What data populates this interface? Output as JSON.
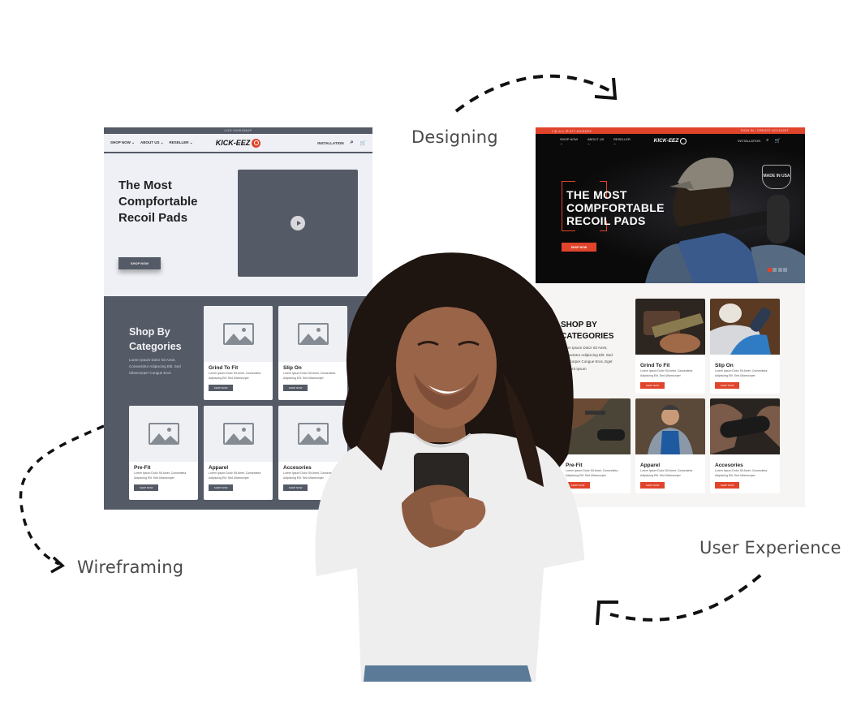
{
  "labels": {
    "designing": "Designing",
    "wireframing": "Wireframing",
    "user_experience": "User Experience"
  },
  "wireframe": {
    "topbar": "LOG IN/SIGNUP",
    "nav": {
      "menu": [
        "SHOP NOW ⌄",
        "ABOUT US ⌄",
        "RESELLER ⌄"
      ],
      "logo": "KICK-EEZ",
      "installation": "INSTALLATION",
      "search_icon": "⌕",
      "cart_icon": "🛒"
    },
    "hero": {
      "title": "The Most Compfortable Recoil Pads",
      "button": "SHOP NOW",
      "video_icon": "play-icon"
    },
    "categories": {
      "title": "Shop By Categories",
      "description": "Lorem Ipsum Dolor Sit Amet, Consectetur Adipiscing Elit. Sed Ullamcorper Congue Eros",
      "items": [
        {
          "name": "Grind To Fit",
          "desc": "Lorem Ipsum Dolor Sit Amet, Consectetur Adipiscing Elit. Sed Ullamcorper",
          "button": "SHOP NOW"
        },
        {
          "name": "Slip On",
          "desc": "Lorem Ipsum Dolor Sit Amet, Consectetur Adipiscing Elit. Sed Ullamcorper",
          "button": "SHOP NOW"
        },
        {
          "name": "Pre-Fit",
          "desc": "Lorem Ipsum Dolor Sit Amet, Consectetur Adipiscing Elit. Sed Ullamcorper",
          "button": "SHOP NOW"
        },
        {
          "name": "Apparel",
          "desc": "Lorem Ipsum Dolor Sit Amet, Consectetur Adipiscing Elit. Sed Ullamcorper",
          "button": "SHOP NOW"
        },
        {
          "name": "Accesories",
          "desc": "Lorem Ipsum Dolor Sit Amet, Consectetur Adipiscing Elit. Sed Ullamcorper",
          "button": "SHOP NOW"
        }
      ]
    }
  },
  "design": {
    "topbar_left": "f  ◎  in  ▷   ✆ 877-KICKEEZ",
    "topbar_right": "SIGN IN / CREATE ACCOUNT",
    "nav": {
      "menu": [
        "SHOP NOW ⌄",
        "ABOUT US ⌄",
        "RESELLER ⌄"
      ],
      "logo": "KICK-EEZ",
      "installation": "INSTALLATION",
      "search_icon": "⌕",
      "cart_icon": "🛒"
    },
    "hero": {
      "title": "THE MOST COMPFORTABLE RECOIL PADS",
      "button": "SHOP NOW",
      "badge": "MADE IN USA",
      "slides": 4,
      "active_slide": 1
    },
    "categories": {
      "title": "SHOP BY CATEGORIES",
      "description": "Lorem Ipsum Dolor Sit Amet, Consectetur Adipiscing Elit. Sed Ullamcorper Congue Eros, Eget Tincidunt Ipsum",
      "items": [
        {
          "name": "Grind To Fit",
          "desc": "Lorem Ipsum Dolor Sit Amet, Consectetur Adipiscing Elit. Sed Ullamcorper",
          "button": "SHOP NOW"
        },
        {
          "name": "Slip On",
          "desc": "Lorem Ipsum Dolor Sit Amet, Consectetur Adipiscing Elit. Sed Ullamcorper",
          "button": "SHOP NOW"
        },
        {
          "name": "Pre-Fit",
          "desc": "Lorem Ipsum Dolor Sit Amet, Consectetur Adipiscing Elit. Sed Ullamcorper",
          "button": "SHOP NOW"
        },
        {
          "name": "Apparel",
          "desc": "Lorem Ipsum Dolor Sit Amet, Consectetur Adipiscing Elit. Sed Ullamcorper",
          "button": "SHOP NOW"
        },
        {
          "name": "Accesories",
          "desc": "Lorem Ipsum Dolor Sit Amet, Consectetur Adipiscing Elit. Sed Ullamcorper",
          "button": "SHOP NOW"
        }
      ]
    }
  },
  "colors": {
    "brand_red": "#e0442b",
    "wireframe_gray": "#545a66",
    "wireframe_bg": "#eef0f6",
    "design_dark": "#0a0a0a"
  }
}
